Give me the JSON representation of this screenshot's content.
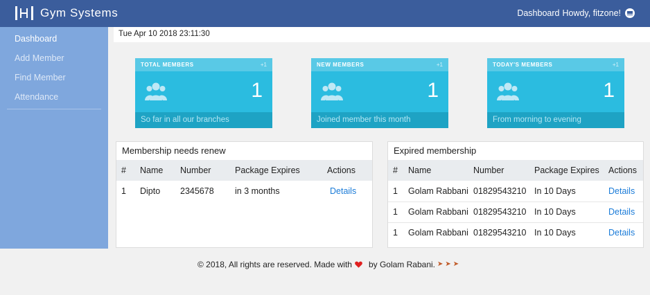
{
  "header": {
    "brand": "Gym Systems",
    "dashboard_label": "Dashboard",
    "greeting": "Howdy, fitzone!"
  },
  "sidebar": {
    "items": [
      {
        "label": "Dashboard",
        "active": true
      },
      {
        "label": "Add Member",
        "active": false
      },
      {
        "label": "Find Member",
        "active": false
      },
      {
        "label": "Attendance",
        "active": false
      }
    ]
  },
  "datetime": "Tue Apr 10 2018 23:11:30",
  "cards": [
    {
      "title": "TOTAL MEMBERS",
      "badge": "+1",
      "count": "1",
      "subtitle": "So far in all our branches",
      "icon": "users-icon"
    },
    {
      "title": "NEW MEMBERS",
      "badge": "+1",
      "count": "1",
      "subtitle": "Joined member this month",
      "icon": "users-icon"
    },
    {
      "title": "TODAY'S MEMBERS",
      "badge": "+1",
      "count": "1",
      "subtitle": "From morning to evening",
      "icon": "users-icon"
    }
  ],
  "renew_panel": {
    "title": "Membership needs renew",
    "columns": [
      "#",
      "Name",
      "Number",
      "Package Expires",
      "Actions"
    ],
    "rows": [
      {
        "index": "1",
        "name": "Dipto",
        "number": "2345678",
        "expires": "in 3 months",
        "action": "Details"
      }
    ]
  },
  "expired_panel": {
    "title": "Expired membership",
    "columns": [
      "#",
      "Name",
      "Number",
      "Package Expires",
      "Actions"
    ],
    "rows": [
      {
        "index": "1",
        "name": "Golam Rabbani",
        "number": "01829543210",
        "expires": "In 10 Days",
        "action": "Details"
      },
      {
        "index": "1",
        "name": "Golam Rabbani",
        "number": "01829543210",
        "expires": "In 10 Days",
        "action": "Details"
      },
      {
        "index": "1",
        "name": "Golam Rabbani",
        "number": "01829543210",
        "expires": "In 10 Days",
        "action": "Details"
      }
    ]
  },
  "footer": {
    "text_before": "© 2018, All rights are reserved. Made with",
    "text_after": "by Golam Rabani.",
    "heart_color": "#e02020"
  },
  "colors": {
    "topbar": "#3b5d9c",
    "sidebar": "#7fa7dd",
    "card": "#2bbce0",
    "link": "#1a7bd8"
  }
}
